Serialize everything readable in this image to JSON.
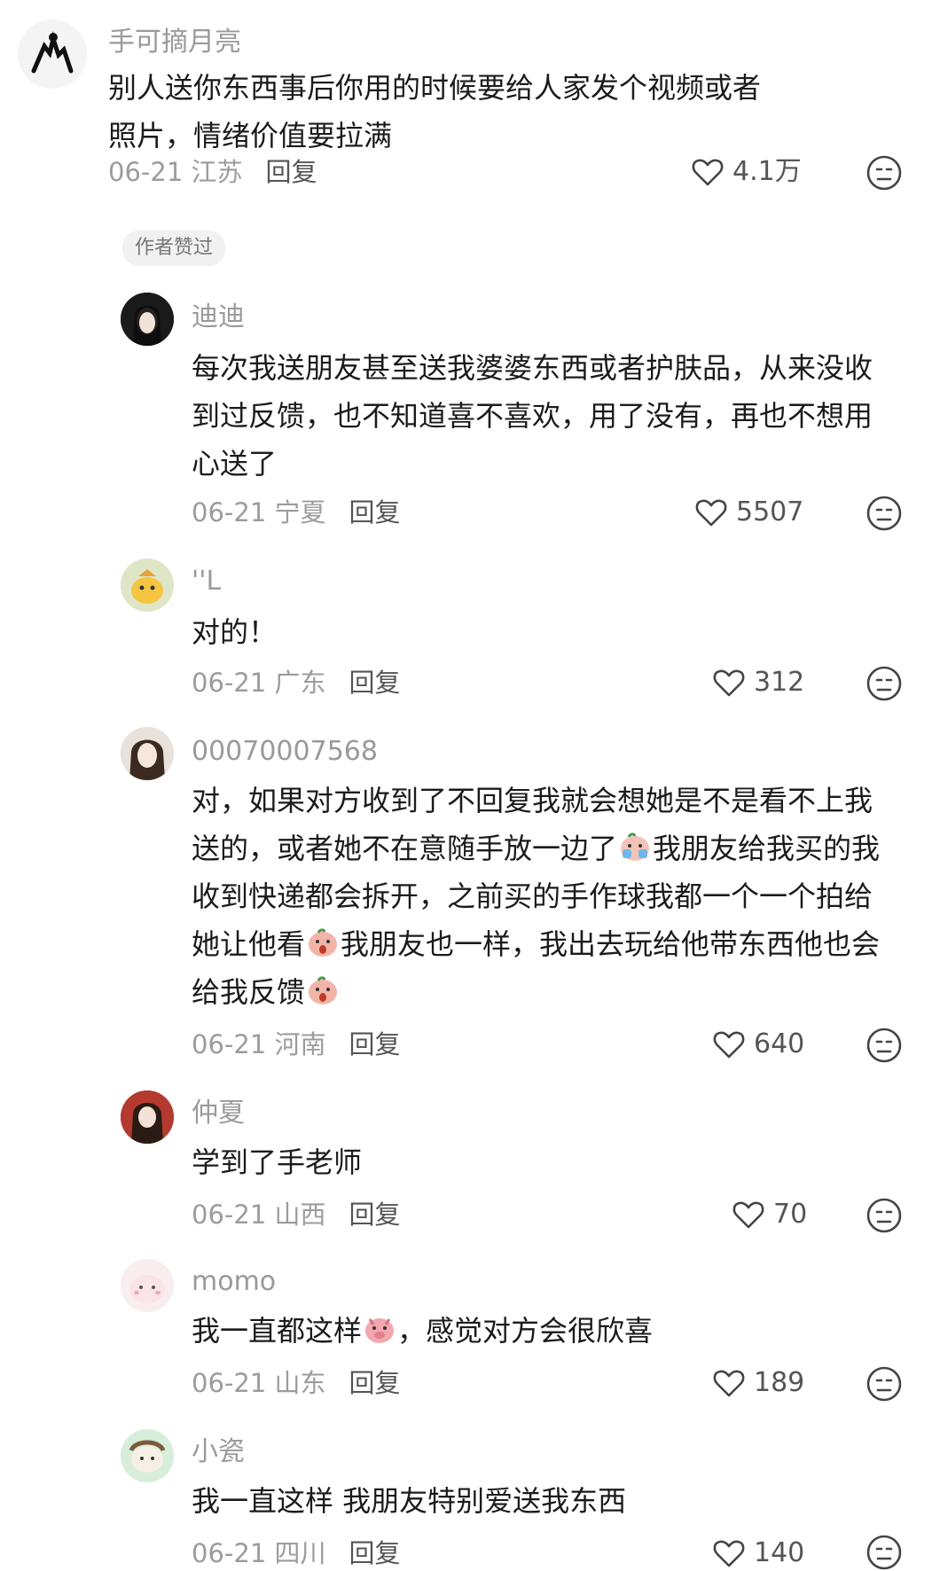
{
  "comments": [
    {
      "name": "手可摘月亮",
      "text": "别人送你东西事后你用的时候要给人家发个视频或者照片，情绪价值要拉满",
      "date": "06-21 江苏",
      "reply": "回复",
      "likes": "4.1万",
      "badge": "作者赞过"
    },
    {
      "name": "迪迪",
      "text": "每次我送朋友甚至送我婆婆东西或者护肤品，从来没收到过反馈，也不知道喜不喜欢，用了没有，再也不想用心送了",
      "date": "06-21 宁夏",
      "reply": "回复",
      "likes": "5507"
    },
    {
      "name": "''L",
      "text": "对的！",
      "date": "06-21 广东",
      "reply": "回复",
      "likes": "312"
    },
    {
      "name": "00070007568",
      "text_parts": [
        "对，如果对方收到了不回复我就会想她是不是看不上我送的，或者她不在意随手放一边了",
        "我朋友给我买的我收到快递都会拆开，之前买的手作球我都一个一个拍给她让他看",
        "我朋友也一样，我出去玩给他带东西他也会给我反馈"
      ],
      "date": "06-21 河南",
      "reply": "回复",
      "likes": "640"
    },
    {
      "name": "仲夏",
      "text": "学到了手老师",
      "date": "06-21 山西",
      "reply": "回复",
      "likes": "70"
    },
    {
      "name": "momo",
      "text_parts": [
        "我一直都这样",
        "，感觉对方会很欣喜"
      ],
      "date": "06-21 山东",
      "reply": "回复",
      "likes": "189"
    },
    {
      "name": "小瓷",
      "text": "我一直这样 我朋友特别爱送我东西",
      "date": "06-21 四川",
      "reply": "回复",
      "likes": "140"
    }
  ],
  "icons": {
    "like": "heart-outline-icon",
    "dislike": "neutral-face-icon"
  },
  "colors": {
    "text": "#1b1b1b",
    "secondary": "#9a9a9a",
    "badge_bg": "#f1f1f1"
  }
}
